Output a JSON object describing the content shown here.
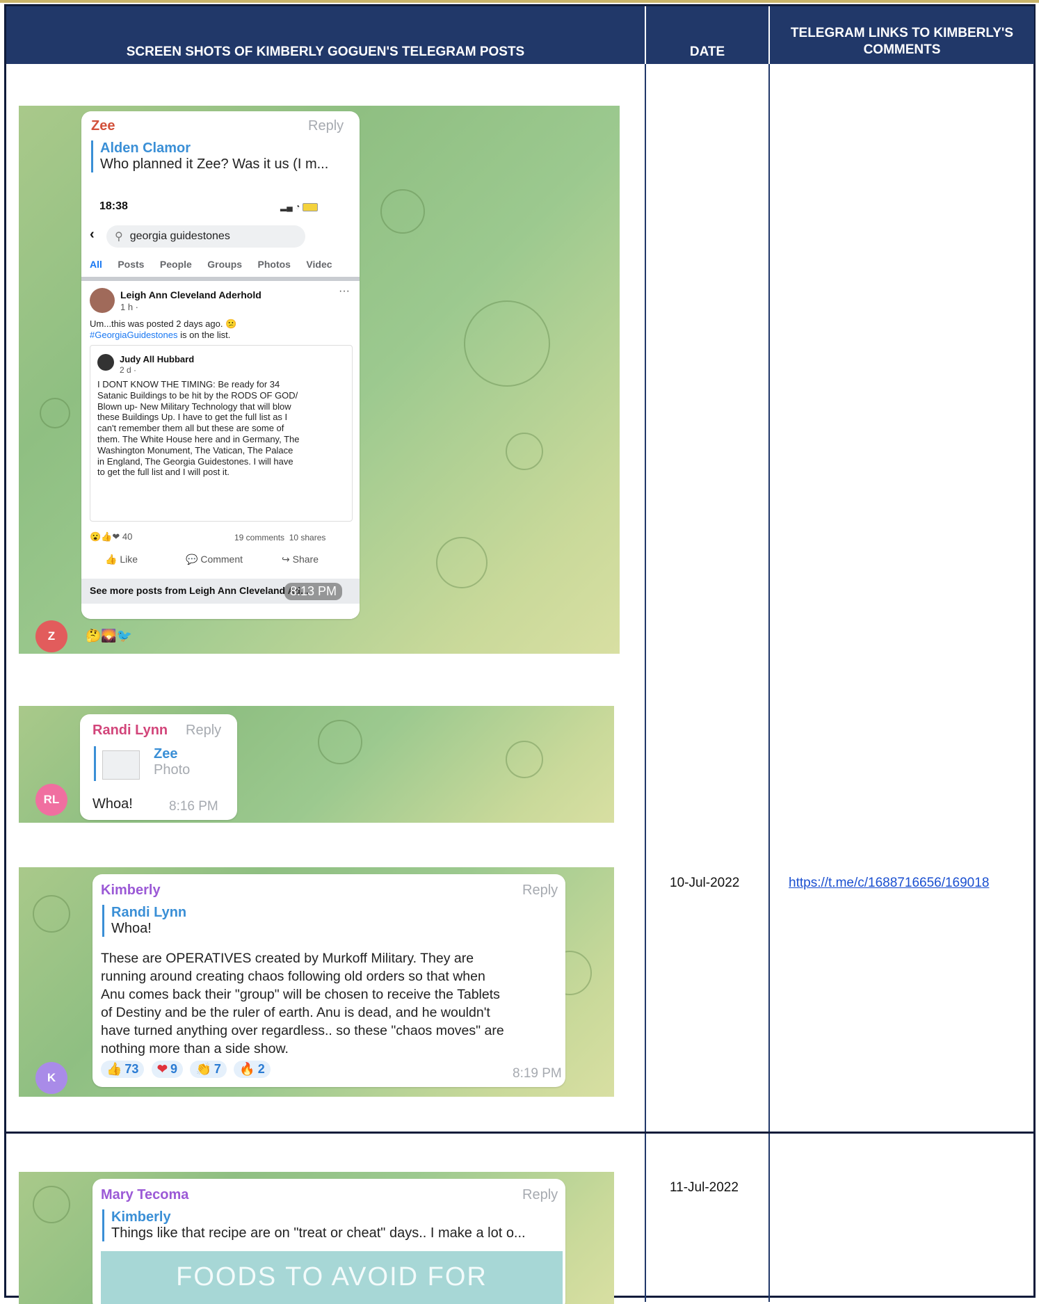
{
  "header": {
    "col1": "SCREEN SHOTS OF KIMBERLY GOGUEN'S TELEGRAM POSTS",
    "col2": "DATE",
    "col3": "TELEGRAM LINKS TO KIMBERLY'S COMMENTS"
  },
  "rows": [
    {
      "date": "10-Jul-2022",
      "link": "https://t.me/c/1688716656/169018"
    },
    {
      "date": "11-Jul-2022",
      "link": ""
    }
  ],
  "shot1": {
    "sender": "Zee",
    "reply": "Reply",
    "quote_name": "Alden Clamor",
    "quote_text": "Who planned it Zee? Was it us (I m...",
    "phone_time": "18:38",
    "search_query": "georgia guidestones",
    "tabs": [
      "All",
      "Posts",
      "People",
      "Groups",
      "Photos",
      "Videc"
    ],
    "post_author": "Leigh Ann Cleveland Aderhold",
    "post_meta": "1 h · ",
    "post_text_1": "Um...this was posted 2 days ago.",
    "post_hashtag": "#GeorgiaGuidestones",
    "post_text_2": " is on the list.",
    "shared_author": "Judy All Hubbard",
    "shared_meta": "2 d · ",
    "shared_lines": [
      "I DONT KNOW THE TIMING: Be ready for 34",
      "Satanic Buildings to be hit by the RODS OF GOD/",
      "Blown up- New Military Technology that will blow",
      "these Buildings Up. I have to get the full list as I",
      "can't remember them all but these are some of",
      "them. The White House here and in Germany, The",
      "Washington Monument, The Vatican, The Palace",
      "in England, The Georgia Guidestones. I will have",
      "to get the full list and I will post it."
    ],
    "reactions_count": "40",
    "comments": "19 comments",
    "shares": "10 shares",
    "like": "Like",
    "comment": "Comment",
    "share": "Share",
    "see_more": "See more posts from Leigh Ann Cleveland Ad...",
    "time": "8:13 PM",
    "avatar": "Z"
  },
  "shot2": {
    "sender": "Randi Lynn",
    "reply": "Reply",
    "quote_name": "Zee",
    "quote_text": "Photo",
    "message": "Whoa!",
    "time": "8:16 PM",
    "avatar": "RL"
  },
  "shot3": {
    "sender": "Kimberly",
    "reply": "Reply",
    "quote_name": "Randi Lynn",
    "quote_text": "Whoa!",
    "lines": [
      "These are OPERATIVES created by Murkoff Military. They are",
      "running around creating chaos following old orders so that when",
      "Anu comes back their \"group\" will be chosen to receive the Tablets",
      "of Destiny and be the ruler of earth. Anu is dead, and he wouldn't",
      "have turned anything over regardless.. so these \"chaos moves\" are",
      "nothing more than a side show."
    ],
    "reactions": [
      {
        "emoji": "👍",
        "count": "73"
      },
      {
        "emoji": "❤",
        "count": "9"
      },
      {
        "emoji": "👏",
        "count": "7"
      },
      {
        "emoji": "🔥",
        "count": "2"
      }
    ],
    "time": "8:19 PM",
    "avatar": "K"
  },
  "shot4": {
    "sender": "Mary Tecoma",
    "reply": "Reply",
    "quote_name": "Kimberly",
    "quote_text": "Things like that recipe are on \"treat or cheat\" days.. I make a lot o...",
    "banner": "FOODS TO AVOID FOR"
  },
  "colors": {
    "header_bg": "#213869",
    "zee": "#d2513b",
    "randi": "#d2457a",
    "kimberly": "#9b59d6",
    "mary": "#9b59d6",
    "quote_blue": "#3a8fd6"
  }
}
